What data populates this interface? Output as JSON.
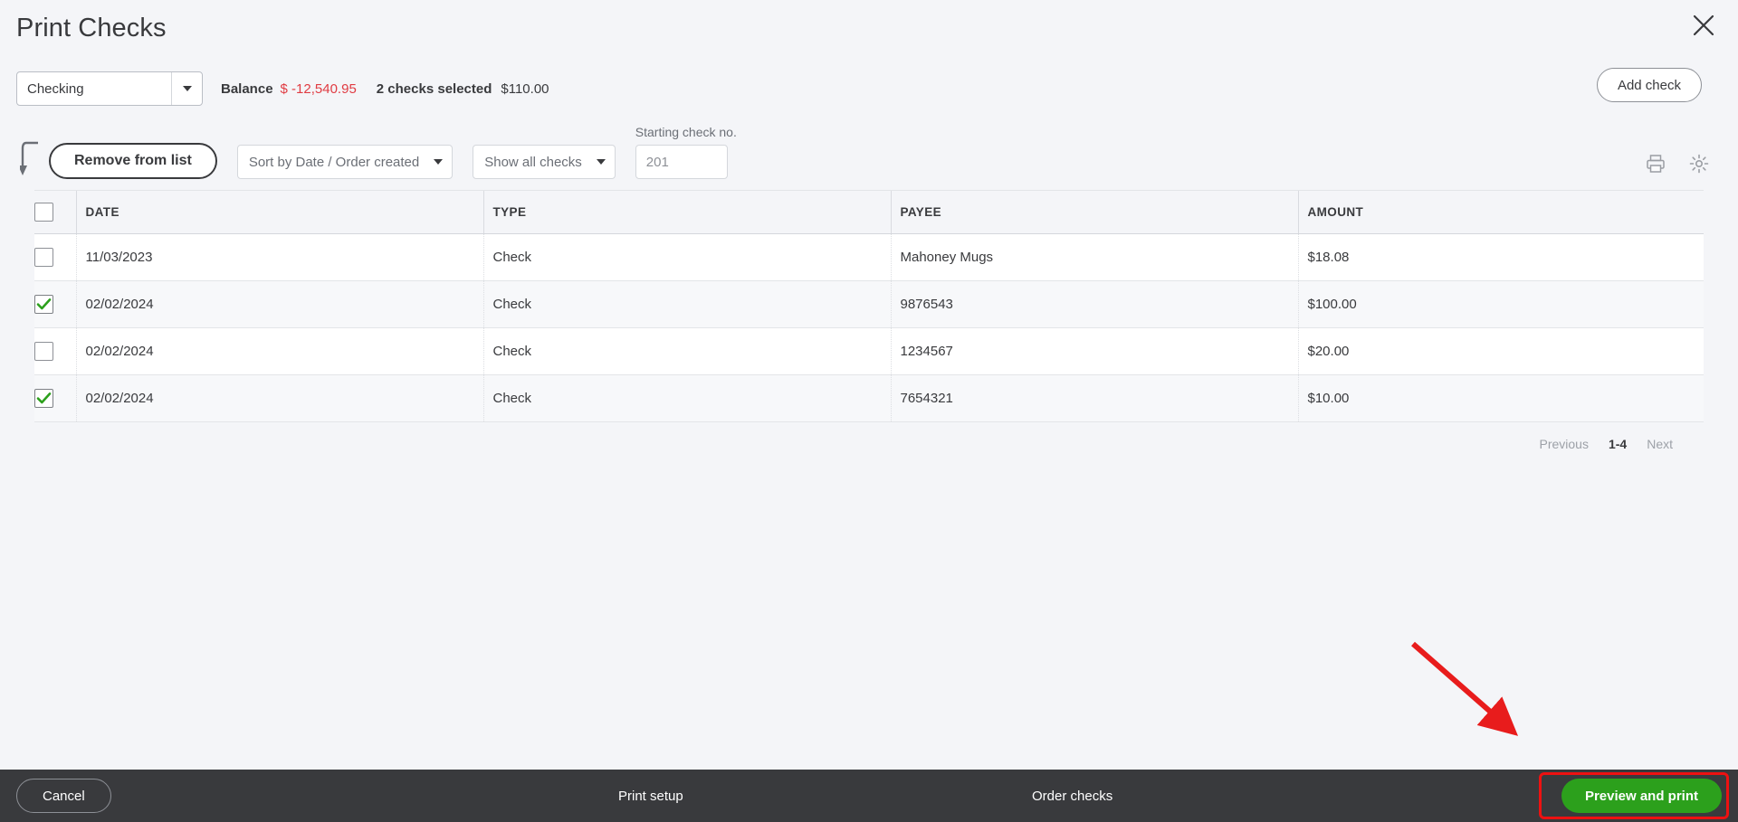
{
  "window": {
    "title": "Print Checks",
    "close_icon": "close-icon"
  },
  "account": {
    "selected": "Checking",
    "dropdown_icon": "chevron-down-icon"
  },
  "summary": {
    "balance_label": "Balance",
    "balance_value": "$ -12,540.95",
    "balance_color": "#e03b42",
    "selected_label": "2 checks selected",
    "selected_amount": "$110.00"
  },
  "header_actions": {
    "add_check": "Add check"
  },
  "toolbar": {
    "remove_from_list": "Remove from list",
    "sort_dropdown": "Sort by Date / Order created",
    "filter_dropdown": "Show all checks",
    "starting_check_label": "Starting check no.",
    "starting_check_placeholder": "201",
    "starting_check_value": "",
    "print_icon": "printer-icon",
    "settings_icon": "gear-icon",
    "hook_icon": "curved-arrow-icon"
  },
  "table": {
    "columns": [
      "DATE",
      "TYPE",
      "PAYEE",
      "AMOUNT"
    ],
    "select_all_checked": false,
    "rows": [
      {
        "checked": false,
        "date": "11/03/2023",
        "type": "Check",
        "payee": "Mahoney Mugs",
        "amount": "$18.08"
      },
      {
        "checked": true,
        "date": "02/02/2024",
        "type": "Check",
        "payee": "9876543",
        "amount": "$100.00"
      },
      {
        "checked": false,
        "date": "02/02/2024",
        "type": "Check",
        "payee": "1234567",
        "amount": "$20.00"
      },
      {
        "checked": true,
        "date": "02/02/2024",
        "type": "Check",
        "payee": "7654321",
        "amount": "$10.00"
      }
    ]
  },
  "pagination": {
    "previous": "Previous",
    "range": "1-4",
    "next": "Next"
  },
  "footer": {
    "cancel": "Cancel",
    "print_setup": "Print setup",
    "order_checks": "Order checks",
    "preview_and_print": "Preview and print",
    "preview_button_color": "#2ca01c",
    "highlight_color": "#ee1111"
  },
  "annotation": {
    "arrow_color": "#e81c1c"
  }
}
